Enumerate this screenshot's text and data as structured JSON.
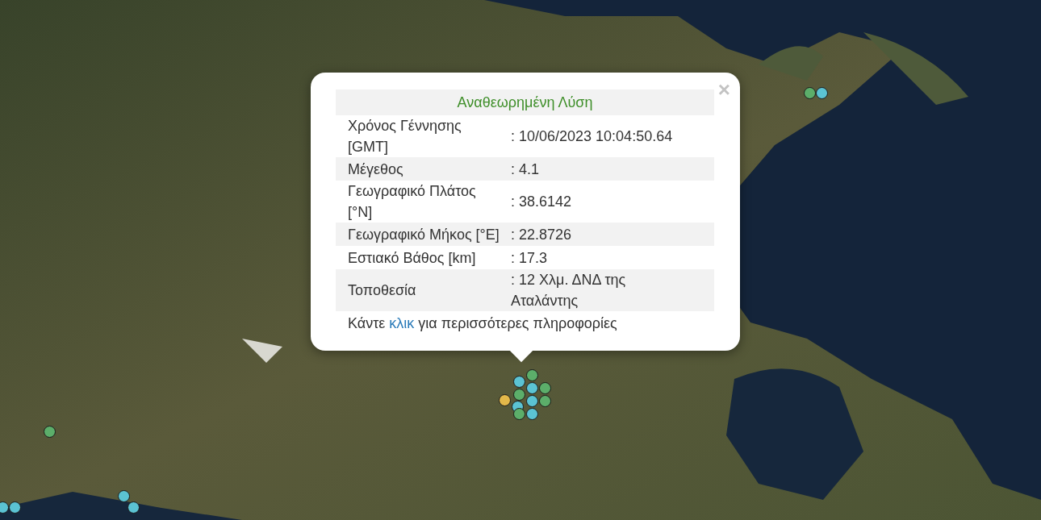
{
  "popup": {
    "title": "Αναθεωρημένη Λύση",
    "close": "×",
    "rows": [
      {
        "label": "Χρόνος Γέννησης [GMT]",
        "value": ": 10/06/2023 10:04:50.64"
      },
      {
        "label": "Μέγεθος",
        "value": ": 4.1"
      },
      {
        "label": "Γεωγραφικό Πλάτος [°N]",
        "value": ": 38.6142"
      },
      {
        "label": "Γεωγραφικό Μήκος [°E]",
        "value": ": 22.8726"
      },
      {
        "label": "Εστιακό Βάθος [km]",
        "value": ": 17.3"
      },
      {
        "label": "Τοποθεσία",
        "value": ": 12 Χλμ. ΔΝΔ της Αταλάντης"
      }
    ],
    "footer": {
      "before": "Κάντε",
      "link": "κλικ",
      "after": "για περισσότερες πληροφορίες"
    }
  },
  "markers": [
    {
      "color": "#5cae6a"
    },
    {
      "color": "#5bc3d3"
    },
    {
      "color": "#5cae6a"
    },
    {
      "color": "#5bc3d3"
    },
    {
      "color": "#5bc3d3"
    },
    {
      "color": "#5bc3d3"
    },
    {
      "color": "#5bc3d3"
    },
    {
      "color": "#e3b84a"
    },
    {
      "color": "#5bc3d3"
    },
    {
      "color": "#5bc3d3"
    },
    {
      "color": "#5cae6a"
    },
    {
      "color": "#5bc3d3"
    },
    {
      "color": "#5cae6a"
    },
    {
      "color": "#5cae6a"
    },
    {
      "color": "#5bc3d3"
    },
    {
      "color": "#5cae6a"
    },
    {
      "color": "#5bc3d3"
    },
    {
      "color": "#5cae6a"
    }
  ]
}
